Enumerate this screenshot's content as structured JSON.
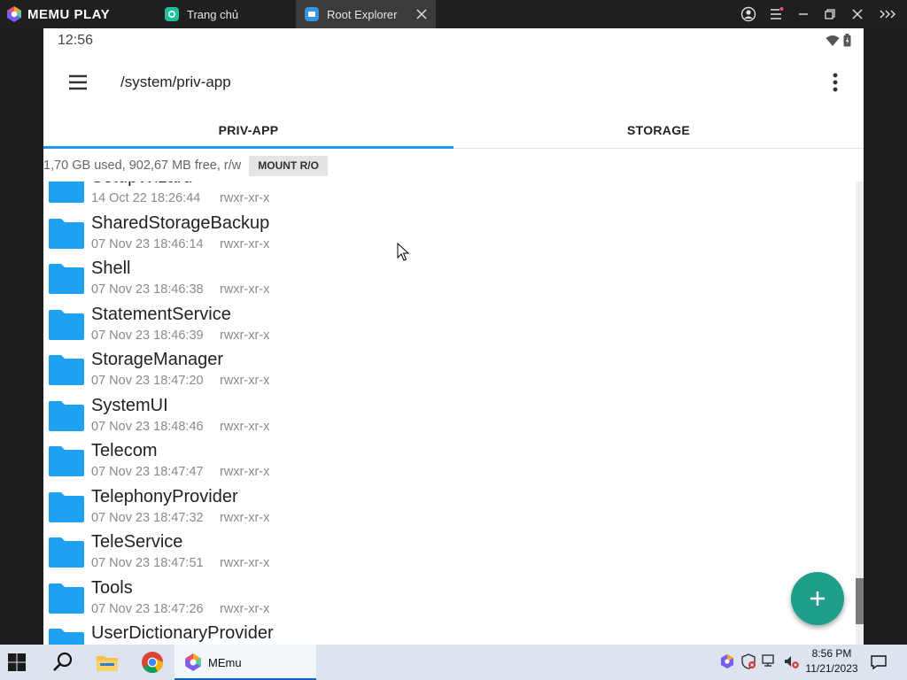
{
  "emulator": {
    "brand": "MEMU PLAY",
    "tabs": [
      {
        "label": "Trang chủ",
        "icon": "memu-home-icon"
      },
      {
        "label": "Root Explorer",
        "icon": "root-explorer-icon"
      }
    ]
  },
  "android": {
    "status_bar": {
      "time": "12:56"
    },
    "toolbar": {
      "path": "/system/priv-app"
    },
    "tabs": [
      {
        "label": "PRIV-APP",
        "selected": true
      },
      {
        "label": "STORAGE",
        "selected": false
      }
    ],
    "storage_info": "1,70 GB used, 902,67 MB free, r/w",
    "mount_button": "MOUNT R/O",
    "files": [
      {
        "name": "SetupWizard",
        "date": "14 Oct 22 18:26:44",
        "perm": "rwxr-xr-x"
      },
      {
        "name": "SharedStorageBackup",
        "date": "07 Nov 23 18:46:14",
        "perm": "rwxr-xr-x"
      },
      {
        "name": "Shell",
        "date": "07 Nov 23 18:46:38",
        "perm": "rwxr-xr-x"
      },
      {
        "name": "StatementService",
        "date": "07 Nov 23 18:46:39",
        "perm": "rwxr-xr-x"
      },
      {
        "name": "StorageManager",
        "date": "07 Nov 23 18:47:20",
        "perm": "rwxr-xr-x"
      },
      {
        "name": "SystemUI",
        "date": "07 Nov 23 18:48:46",
        "perm": "rwxr-xr-x"
      },
      {
        "name": "Telecom",
        "date": "07 Nov 23 18:47:47",
        "perm": "rwxr-xr-x"
      },
      {
        "name": "TelephonyProvider",
        "date": "07 Nov 23 18:47:32",
        "perm": "rwxr-xr-x"
      },
      {
        "name": "TeleService",
        "date": "07 Nov 23 18:47:51",
        "perm": "rwxr-xr-x"
      },
      {
        "name": "Tools",
        "date": "07 Nov 23 18:47:26",
        "perm": "rwxr-xr-x"
      },
      {
        "name": "UserDictionaryProvider",
        "date": "",
        "perm": ""
      }
    ],
    "accent_color": "#2196f3",
    "fab_color": "#1f9e8c",
    "folder_color": "#1ea1f1"
  },
  "taskbar": {
    "memu_label": "MEmu",
    "time": "8:56 PM",
    "date": "11/21/2023"
  }
}
